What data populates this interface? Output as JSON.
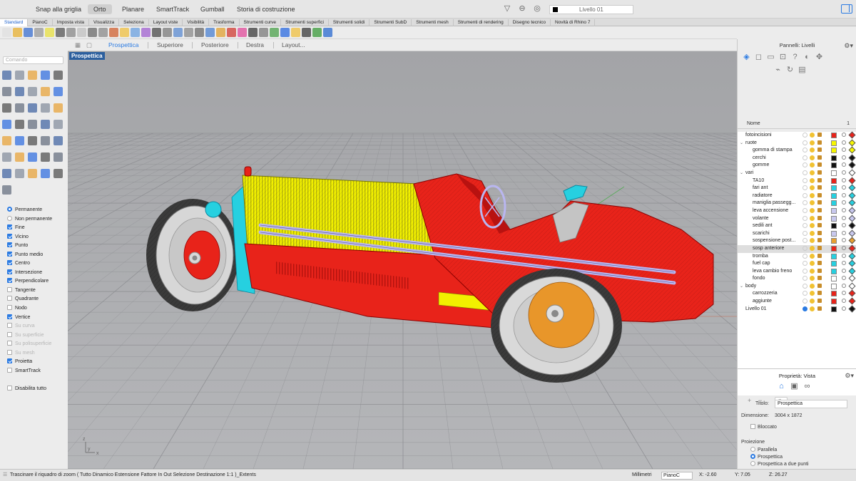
{
  "topbar": {
    "snaps": [
      "Snap alla griglia",
      "Orto",
      "Planare",
      "SmartTrack",
      "Gumball",
      "Storia di costruzione"
    ],
    "active_snap": "Orto",
    "current_layer": "Livello 01"
  },
  "toolbar_tabs": [
    "Standard",
    "PianoC",
    "Imposta vista",
    "Visualizza",
    "Seleziona",
    "Layout viste",
    "Visibilità",
    "Trasforma",
    "Strumenti curve",
    "Strumenti superfici",
    "Strumenti solidi",
    "Strumenti SubD",
    "Strumenti mesh",
    "Strumenti di rendering",
    "Disegno tecnico",
    "Novità di Rhino 7"
  ],
  "command": {
    "placeholder": "Comando"
  },
  "viewport_tabs": [
    "Prospettica",
    "Superiore",
    "Posteriore",
    "Destra",
    "Layout..."
  ],
  "viewport": {
    "label": "Prospettica"
  },
  "osnaps": [
    {
      "label": "Permanente",
      "kind": "radio",
      "checked": true,
      "dim": false
    },
    {
      "label": "Non permanente",
      "kind": "radio",
      "checked": false,
      "dim": false
    },
    {
      "label": "Fine",
      "kind": "check",
      "checked": true,
      "dim": false
    },
    {
      "label": "Vicino",
      "kind": "check",
      "checked": true,
      "dim": false
    },
    {
      "label": "Punto",
      "kind": "check",
      "checked": true,
      "dim": false
    },
    {
      "label": "Punto medio",
      "kind": "check",
      "checked": true,
      "dim": false
    },
    {
      "label": "Centro",
      "kind": "check",
      "checked": true,
      "dim": false
    },
    {
      "label": "Intersezione",
      "kind": "check",
      "checked": true,
      "dim": false
    },
    {
      "label": "Perpendicolare",
      "kind": "check",
      "checked": true,
      "dim": false
    },
    {
      "label": "Tangente",
      "kind": "check",
      "checked": false,
      "dim": false
    },
    {
      "label": "Quadrante",
      "kind": "check",
      "checked": false,
      "dim": false
    },
    {
      "label": "Nodo",
      "kind": "check",
      "checked": false,
      "dim": false
    },
    {
      "label": "Vertice",
      "kind": "check",
      "checked": true,
      "dim": false
    },
    {
      "label": "Su curva",
      "kind": "check",
      "checked": false,
      "dim": true
    },
    {
      "label": "Su superficie",
      "kind": "check",
      "checked": false,
      "dim": true
    },
    {
      "label": "Su polisuperficie",
      "kind": "check",
      "checked": false,
      "dim": true
    },
    {
      "label": "Su mesh",
      "kind": "check",
      "checked": false,
      "dim": true
    },
    {
      "label": "Proietta",
      "kind": "check",
      "checked": true,
      "dim": false
    },
    {
      "label": "SmartTrack",
      "kind": "check",
      "checked": false,
      "dim": false
    },
    {
      "label": "",
      "kind": "spacer",
      "checked": false,
      "dim": false
    },
    {
      "label": "Disabilita tutto",
      "kind": "check",
      "checked": false,
      "dim": false
    }
  ],
  "layers_panel": {
    "title": "Pannelli: Livelli",
    "col_name": "Nome",
    "col_one": "1",
    "layers": [
      {
        "name": "fotoincisioni",
        "level": 0,
        "color": "#e8231a",
        "group": false,
        "selected": false
      },
      {
        "name": "ruote",
        "level": 0,
        "color": "#f6f600",
        "group": true,
        "selected": false
      },
      {
        "name": "gomma di stampa",
        "level": 1,
        "color": "#f6f600",
        "group": false,
        "selected": false
      },
      {
        "name": "cerchi",
        "level": 1,
        "color": "#111111",
        "group": false,
        "selected": false
      },
      {
        "name": "gomme",
        "level": 1,
        "color": "#111111",
        "group": false,
        "selected": false
      },
      {
        "name": "vari",
        "level": 0,
        "color": "#ffffff",
        "group": true,
        "selected": false
      },
      {
        "name": "TA10",
        "level": 1,
        "color": "#e8231a",
        "group": false,
        "selected": false
      },
      {
        "name": "fari ant",
        "level": 1,
        "color": "#26d0e0",
        "group": false,
        "selected": false
      },
      {
        "name": "radiatore",
        "level": 1,
        "color": "#26d0e0",
        "group": false,
        "selected": false
      },
      {
        "name": "maniglia passegg...",
        "level": 1,
        "color": "#26d0e0",
        "group": false,
        "selected": false
      },
      {
        "name": "leva accensione",
        "level": 1,
        "color": "#c8c8ee",
        "group": false,
        "selected": false
      },
      {
        "name": "volante",
        "level": 1,
        "color": "#c8c8ee",
        "group": false,
        "selected": false
      },
      {
        "name": "sedili ant",
        "level": 1,
        "color": "#111111",
        "group": false,
        "selected": false
      },
      {
        "name": "scarichi",
        "level": 1,
        "color": "#c8c8ee",
        "group": false,
        "selected": false
      },
      {
        "name": "sospensione post...",
        "level": 1,
        "color": "#e8a030",
        "group": false,
        "selected": false
      },
      {
        "name": "sosp anteriore",
        "level": 1,
        "color": "#e8231a",
        "group": false,
        "selected": true
      },
      {
        "name": "tromba",
        "level": 1,
        "color": "#26d0e0",
        "group": false,
        "selected": false
      },
      {
        "name": "fuel cap",
        "level": 1,
        "color": "#26d0e0",
        "group": false,
        "selected": false
      },
      {
        "name": "leva cambio freno",
        "level": 1,
        "color": "#26d0e0",
        "group": false,
        "selected": false
      },
      {
        "name": "fondo",
        "level": 1,
        "color": "#ffffff",
        "group": false,
        "selected": false
      },
      {
        "name": "body",
        "level": 0,
        "color": "#ffffff",
        "group": true,
        "selected": false
      },
      {
        "name": "carrozzeria",
        "level": 1,
        "color": "#e8231a",
        "group": false,
        "selected": false
      },
      {
        "name": "aggiunte",
        "level": 1,
        "color": "#e8231a",
        "group": false,
        "selected": false
      },
      {
        "name": "Livello 01",
        "level": 0,
        "color": "#111111",
        "group": false,
        "selected": false
      }
    ]
  },
  "layers_footer": {
    "add": "+",
    "remove": "−"
  },
  "view_props": {
    "title": "Proprietà: Vista",
    "title_label": "Titolo:",
    "title_value": "Prospettica",
    "dim_label": "Dimensione:",
    "dim_value": "3004 x 1872",
    "locked_label": "Bloccato",
    "projection_label": "Proiezione",
    "projections": [
      "Parallela",
      "Prospettica",
      "Prospettica a due punti"
    ],
    "projection_selected": "Prospettica"
  },
  "status": {
    "message": "Trascinare il riquadro di zoom ( Tutto Dinamico Estensione Fattore In Out Selezione Destinazione 1:1 )_Extents",
    "units": "Millimetri",
    "plane": "PianoC",
    "x": "X: -2.60",
    "y": "Y: 7.05",
    "z": "Z: 26.27"
  },
  "colors": {
    "accent": "#2a7ae2",
    "body_red": "#e8231a",
    "hood_yellow": "#f2f000",
    "cyan": "#26d0e0",
    "orange": "#e8962a",
    "exhaust": "#b9b6f0"
  }
}
